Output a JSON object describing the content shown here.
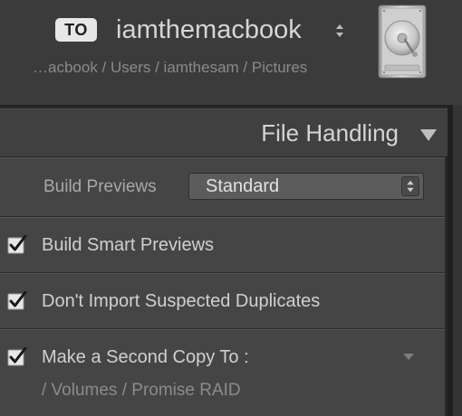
{
  "destination": {
    "badge": "TO",
    "volume_name": "iamthemacbook",
    "path": "…acbook / Users / iamthesam / Pictures",
    "stepper_icon": "up-down-stepper-icon",
    "drive_icon": "hard-drive-icon"
  },
  "file_handling": {
    "title": "File Handling",
    "toggle_icon": "triangle-down-icon",
    "build_previews": {
      "label": "Build Previews",
      "value": "Standard"
    },
    "options": [
      {
        "label": "Build Smart Previews",
        "checked": true
      },
      {
        "label": "Don't Import Suspected Duplicates",
        "checked": true
      },
      {
        "label": "Make a Second Copy To :",
        "checked": true
      }
    ],
    "second_copy_path": "/ Volumes / Promise RAID"
  },
  "colors": {
    "panel_bg": "#454545",
    "header_bg": "#3b3b3b",
    "text_primary": "#d0d0d0",
    "text_secondary": "#8c8c8c"
  }
}
